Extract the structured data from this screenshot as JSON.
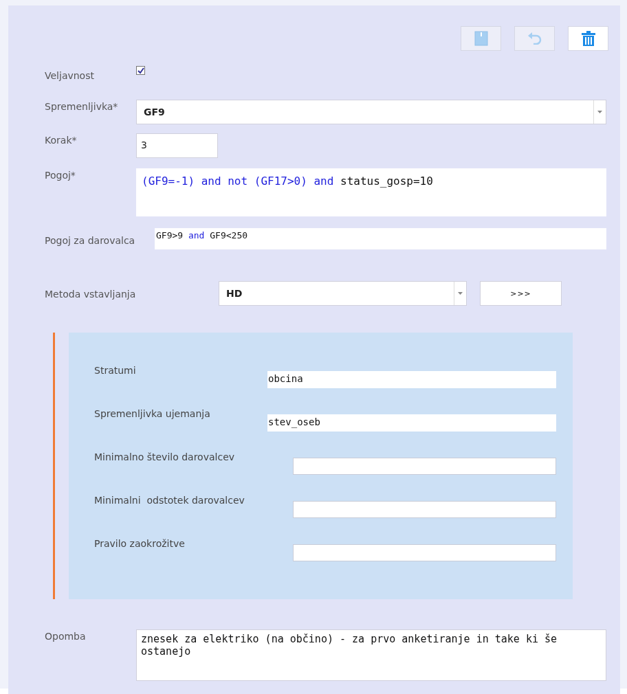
{
  "toolbar": [
    {
      "kind": "save",
      "disabled": true
    },
    {
      "kind": "undo",
      "disabled": true
    },
    {
      "kind": "delete",
      "disabled": false
    }
  ],
  "validity": {
    "label": "Veljavnost",
    "checked": true
  },
  "variable": {
    "label": "Spremenljivka*",
    "value": "GF9"
  },
  "step": {
    "label": "Korak*",
    "value": "3"
  },
  "condition": {
    "label": "Pogoj*",
    "tokens": [
      {
        "text": "(GF9=-1) and not (GF17>0) and",
        "kind": "keyword"
      },
      {
        "text": " status_gosp=10",
        "kind": "plain"
      }
    ]
  },
  "donor_condition": {
    "label": "Pogoj za darovalca",
    "tokens": [
      {
        "text": "GF9>9 ",
        "kind": "plain"
      },
      {
        "text": "and",
        "kind": "keyword"
      },
      {
        "text": " GF9<250",
        "kind": "plain"
      }
    ]
  },
  "method": {
    "label": "Metoda vstavljanja",
    "value": "HD",
    "button": ">>>"
  },
  "method_settings": [
    {
      "label": "Stratumi",
      "value": "obcina",
      "kind": "text"
    },
    {
      "label": "Spremenljivka ujemanja",
      "value": "stev_oseb",
      "kind": "text"
    },
    {
      "label": "Minimalno število darovalcev",
      "kind": "number"
    },
    {
      "label": "Minimalni  odstotek darovalcev",
      "kind": "number"
    },
    {
      "label": "Pravilo zaokrožitve",
      "kind": "number"
    }
  ],
  "note": {
    "label": "Opomba",
    "value": "znesek za elektriko (na občino) - za prvo anketiranje in take ki še ostanejo"
  }
}
